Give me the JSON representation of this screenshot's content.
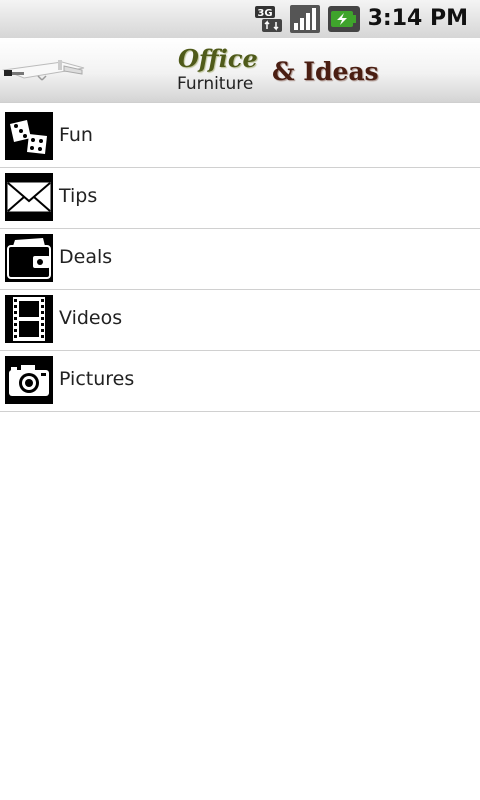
{
  "status_bar": {
    "network_icon": "3g-icon",
    "signal_icon": "signal-icon",
    "battery_icon": "battery-charging-icon",
    "time": "3:14 PM"
  },
  "header": {
    "logo_office": "Office",
    "logo_furniture": "Furniture",
    "logo_ideas": "& Ideas",
    "logo_image": "desk-icon"
  },
  "menu": {
    "items": [
      {
        "label": "Fun",
        "icon": "dice-icon"
      },
      {
        "label": "Tips",
        "icon": "envelope-icon"
      },
      {
        "label": "Deals",
        "icon": "wallet-icon"
      },
      {
        "label": "Videos",
        "icon": "film-strip-icon"
      },
      {
        "label": "Pictures",
        "icon": "camera-icon"
      }
    ]
  },
  "colors": {
    "office_text": "#4f5a1a",
    "ideas_text": "#4a1e12",
    "battery_green": "#3fa42c"
  }
}
